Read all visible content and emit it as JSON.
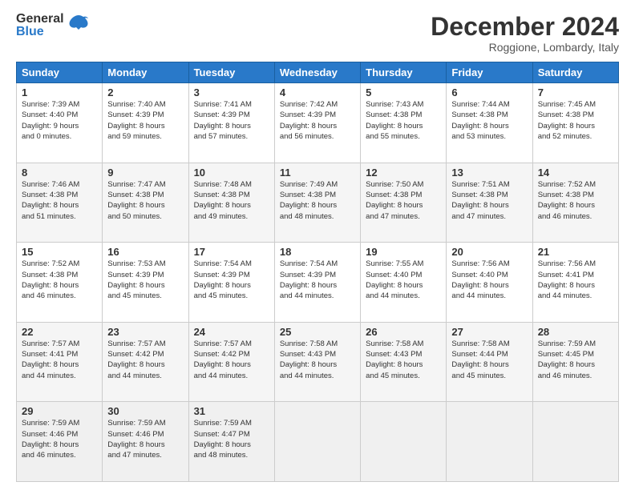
{
  "header": {
    "logo_general": "General",
    "logo_blue": "Blue",
    "month": "December 2024",
    "location": "Roggione, Lombardy, Italy"
  },
  "columns": [
    "Sunday",
    "Monday",
    "Tuesday",
    "Wednesday",
    "Thursday",
    "Friday",
    "Saturday"
  ],
  "weeks": [
    [
      {
        "day": "1",
        "info": "Sunrise: 7:39 AM\nSunset: 4:40 PM\nDaylight: 9 hours\nand 0 minutes."
      },
      {
        "day": "2",
        "info": "Sunrise: 7:40 AM\nSunset: 4:39 PM\nDaylight: 8 hours\nand 59 minutes."
      },
      {
        "day": "3",
        "info": "Sunrise: 7:41 AM\nSunset: 4:39 PM\nDaylight: 8 hours\nand 57 minutes."
      },
      {
        "day": "4",
        "info": "Sunrise: 7:42 AM\nSunset: 4:39 PM\nDaylight: 8 hours\nand 56 minutes."
      },
      {
        "day": "5",
        "info": "Sunrise: 7:43 AM\nSunset: 4:38 PM\nDaylight: 8 hours\nand 55 minutes."
      },
      {
        "day": "6",
        "info": "Sunrise: 7:44 AM\nSunset: 4:38 PM\nDaylight: 8 hours\nand 53 minutes."
      },
      {
        "day": "7",
        "info": "Sunrise: 7:45 AM\nSunset: 4:38 PM\nDaylight: 8 hours\nand 52 minutes."
      }
    ],
    [
      {
        "day": "8",
        "info": "Sunrise: 7:46 AM\nSunset: 4:38 PM\nDaylight: 8 hours\nand 51 minutes."
      },
      {
        "day": "9",
        "info": "Sunrise: 7:47 AM\nSunset: 4:38 PM\nDaylight: 8 hours\nand 50 minutes."
      },
      {
        "day": "10",
        "info": "Sunrise: 7:48 AM\nSunset: 4:38 PM\nDaylight: 8 hours\nand 49 minutes."
      },
      {
        "day": "11",
        "info": "Sunrise: 7:49 AM\nSunset: 4:38 PM\nDaylight: 8 hours\nand 48 minutes."
      },
      {
        "day": "12",
        "info": "Sunrise: 7:50 AM\nSunset: 4:38 PM\nDaylight: 8 hours\nand 47 minutes."
      },
      {
        "day": "13",
        "info": "Sunrise: 7:51 AM\nSunset: 4:38 PM\nDaylight: 8 hours\nand 47 minutes."
      },
      {
        "day": "14",
        "info": "Sunrise: 7:52 AM\nSunset: 4:38 PM\nDaylight: 8 hours\nand 46 minutes."
      }
    ],
    [
      {
        "day": "15",
        "info": "Sunrise: 7:52 AM\nSunset: 4:38 PM\nDaylight: 8 hours\nand 46 minutes."
      },
      {
        "day": "16",
        "info": "Sunrise: 7:53 AM\nSunset: 4:39 PM\nDaylight: 8 hours\nand 45 minutes."
      },
      {
        "day": "17",
        "info": "Sunrise: 7:54 AM\nSunset: 4:39 PM\nDaylight: 8 hours\nand 45 minutes."
      },
      {
        "day": "18",
        "info": "Sunrise: 7:54 AM\nSunset: 4:39 PM\nDaylight: 8 hours\nand 44 minutes."
      },
      {
        "day": "19",
        "info": "Sunrise: 7:55 AM\nSunset: 4:40 PM\nDaylight: 8 hours\nand 44 minutes."
      },
      {
        "day": "20",
        "info": "Sunrise: 7:56 AM\nSunset: 4:40 PM\nDaylight: 8 hours\nand 44 minutes."
      },
      {
        "day": "21",
        "info": "Sunrise: 7:56 AM\nSunset: 4:41 PM\nDaylight: 8 hours\nand 44 minutes."
      }
    ],
    [
      {
        "day": "22",
        "info": "Sunrise: 7:57 AM\nSunset: 4:41 PM\nDaylight: 8 hours\nand 44 minutes."
      },
      {
        "day": "23",
        "info": "Sunrise: 7:57 AM\nSunset: 4:42 PM\nDaylight: 8 hours\nand 44 minutes."
      },
      {
        "day": "24",
        "info": "Sunrise: 7:57 AM\nSunset: 4:42 PM\nDaylight: 8 hours\nand 44 minutes."
      },
      {
        "day": "25",
        "info": "Sunrise: 7:58 AM\nSunset: 4:43 PM\nDaylight: 8 hours\nand 44 minutes."
      },
      {
        "day": "26",
        "info": "Sunrise: 7:58 AM\nSunset: 4:43 PM\nDaylight: 8 hours\nand 45 minutes."
      },
      {
        "day": "27",
        "info": "Sunrise: 7:58 AM\nSunset: 4:44 PM\nDaylight: 8 hours\nand 45 minutes."
      },
      {
        "day": "28",
        "info": "Sunrise: 7:59 AM\nSunset: 4:45 PM\nDaylight: 8 hours\nand 46 minutes."
      }
    ],
    [
      {
        "day": "29",
        "info": "Sunrise: 7:59 AM\nSunset: 4:46 PM\nDaylight: 8 hours\nand 46 minutes."
      },
      {
        "day": "30",
        "info": "Sunrise: 7:59 AM\nSunset: 4:46 PM\nDaylight: 8 hours\nand 47 minutes."
      },
      {
        "day": "31",
        "info": "Sunrise: 7:59 AM\nSunset: 4:47 PM\nDaylight: 8 hours\nand 48 minutes."
      },
      {
        "day": "",
        "info": ""
      },
      {
        "day": "",
        "info": ""
      },
      {
        "day": "",
        "info": ""
      },
      {
        "day": "",
        "info": ""
      }
    ]
  ]
}
